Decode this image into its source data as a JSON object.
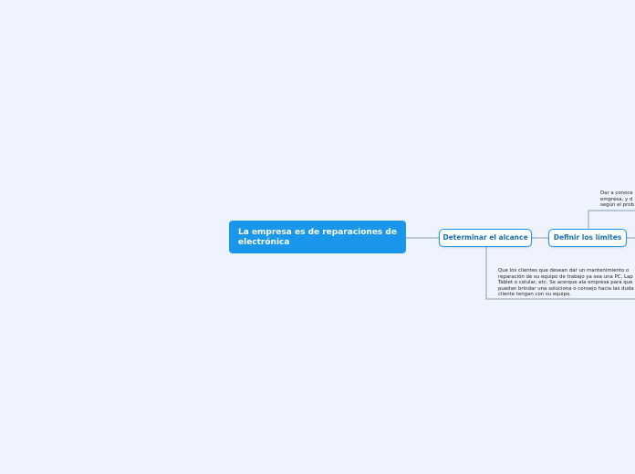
{
  "root": {
    "label": "La empresa es de reparaciones de electrónica"
  },
  "nodes": {
    "alcance": {
      "label": "Determinar el alcance"
    },
    "limites": {
      "label": "Definir los límites"
    }
  },
  "notes": {
    "alcance_note": "Que los clientes que desean dar un mantenimiento o\nreparación de su equipo de trabajo ya sea una PC, Lap\nTablet o celular, etc. Se acerque ala empresa para que\npuedan brindar una soluciona o consejo hacia las duda\ncliente tengan con su equipo.",
    "limites_note": "Dar a conoce\nempresa, y d\nsegún el prob"
  },
  "colors": {
    "background": "#eef3fd",
    "accent": "#1a97ea",
    "connector": "#8a9bb0"
  }
}
